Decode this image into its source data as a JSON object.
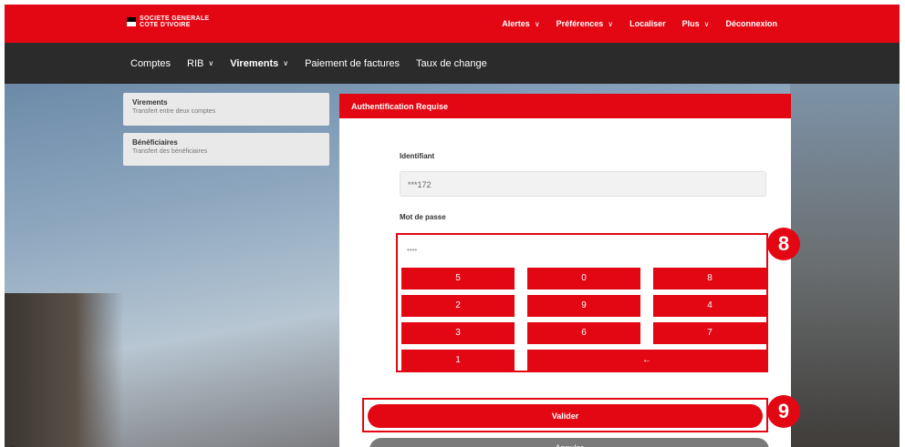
{
  "brand": {
    "line1": "SOCIETE GENERALE",
    "line2": "COTE D'IVOIRE"
  },
  "topnav": [
    {
      "label": "Alertes",
      "dropdown": true
    },
    {
      "label": "Préférences",
      "dropdown": true
    },
    {
      "label": "Localiser",
      "dropdown": false
    },
    {
      "label": "Plus",
      "dropdown": true
    },
    {
      "label": "Déconnexion",
      "dropdown": false
    }
  ],
  "mainnav": [
    {
      "label": "Comptes",
      "dropdown": false
    },
    {
      "label": "RIB",
      "dropdown": true
    },
    {
      "label": "Virements",
      "dropdown": true,
      "active": true
    },
    {
      "label": "Paiement de factures",
      "dropdown": false
    },
    {
      "label": "Taux de change",
      "dropdown": false
    }
  ],
  "sidebar": [
    {
      "title": "Virements",
      "subtitle": "Transfert entre deux comptes"
    },
    {
      "title": "Bénéficiaires",
      "subtitle": "Transfert des bénéficiaires"
    }
  ],
  "panel": {
    "title": "Authentification Requise",
    "id_label": "Identifiant",
    "id_value": "***172",
    "pwd_label": "Mot de passe",
    "pwd_value": "••••"
  },
  "keypad": [
    "5",
    "0",
    "8",
    "2",
    "9",
    "4",
    "3",
    "6",
    "7",
    "1",
    "←"
  ],
  "buttons": {
    "submit": "Valider",
    "cancel": "Annuler"
  },
  "badges": {
    "keypad": "8",
    "submit": "9"
  },
  "colors": {
    "brand_red": "#e30613",
    "nav_dark": "#2b2b2b",
    "cancel_gray": "#7a7a7a"
  },
  "chevron": "∨"
}
